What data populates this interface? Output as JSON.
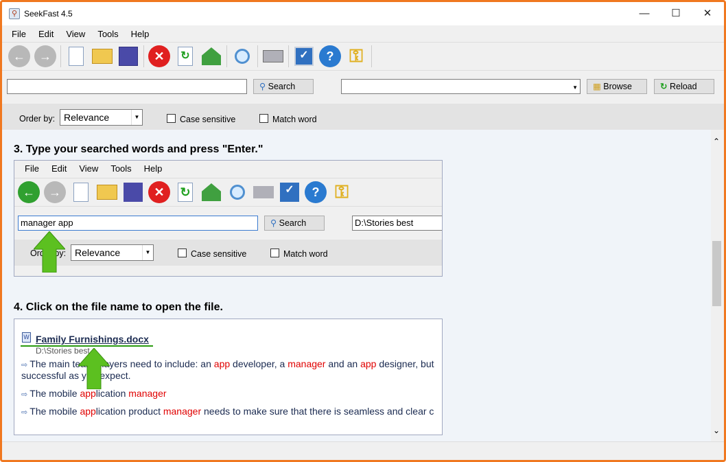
{
  "window": {
    "title": "SeekFast 4.5",
    "minimize": "—",
    "maximize": "☐",
    "close": "✕"
  },
  "menu": [
    "File",
    "Edit",
    "View",
    "Tools",
    "Help"
  ],
  "toolbar": [
    "back-icon",
    "forward-icon",
    "new-icon",
    "open-icon",
    "save-icon",
    "stop-icon",
    "refresh-icon",
    "home-icon",
    "find-icon",
    "print-icon",
    "options-icon",
    "help-icon",
    "key-icon"
  ],
  "search": {
    "query": "",
    "search_label": "Search",
    "folder": "",
    "browse_label": "Browse",
    "reload_label": "Reload"
  },
  "order": {
    "label": "Order by:",
    "value": "Relevance",
    "case_sensitive": "Case sensitive",
    "match_word": "Match word"
  },
  "content": {
    "step3": "3. Type your searched words and press \"Enter.\"",
    "inner": {
      "menu": [
        "File",
        "Edit",
        "View",
        "Tools",
        "Help"
      ],
      "query": "manager app",
      "search_label": "Search",
      "folder": "D:\\Stories best",
      "order_label": "Order by:",
      "order_value": "Relevance",
      "case_sensitive": "Case sensitive",
      "match_word": "Match word"
    },
    "step4": "4. Click on the file name to open the file.",
    "result": {
      "file": "Family Furnishings.docx",
      "path": "D:\\Stories best",
      "snippets": [
        [
          {
            "t": "The main team players need to include: an "
          },
          {
            "t": "app",
            "h": 1
          },
          {
            "t": " developer, a "
          },
          {
            "t": "manager",
            "h": 1
          },
          {
            "t": " and an "
          },
          {
            "t": "app",
            "h": 1
          },
          {
            "t": " designer, but"
          }
        ],
        [
          {
            "t": "successful as you expect."
          }
        ],
        [
          {
            "t": "The mobile "
          },
          {
            "t": "app",
            "h": 1
          },
          {
            "t": "lication "
          },
          {
            "t": "manager",
            "h": 1
          }
        ],
        [
          {
            "t": "The mobile "
          },
          {
            "t": "app",
            "h": 1
          },
          {
            "t": "lication product "
          },
          {
            "t": "manager",
            "h": 1
          },
          {
            "t": " needs to make sure that there is seamless and clear c"
          }
        ]
      ]
    }
  },
  "colors": {
    "accent_border": "#f07820",
    "highlight": "#e00000",
    "arrow": "#5cc020"
  }
}
